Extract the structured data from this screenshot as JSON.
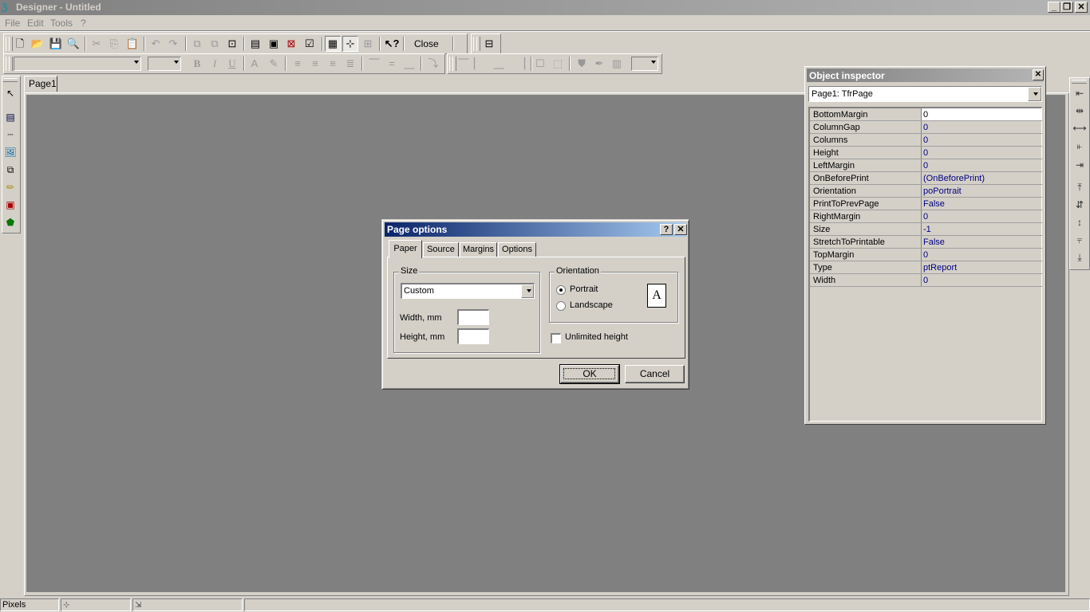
{
  "window": {
    "title": "Designer - Untitled"
  },
  "menu": [
    "File",
    "Edit",
    "Tools",
    "?"
  ],
  "toolbar": {
    "close_label": "Close"
  },
  "page_tab": {
    "label": "Page1"
  },
  "statusbar": {
    "units": "Pixels"
  },
  "dialog": {
    "title": "Page options",
    "help_glyph": "?",
    "close_glyph": "✕",
    "tabs": [
      "Paper",
      "Source",
      "Margins",
      "Options"
    ],
    "size_group": "Size",
    "size_value": "Custom",
    "width_label": "Width, mm",
    "height_label": "Height, mm",
    "width_value": "",
    "height_value": "",
    "orientation_group": "Orientation",
    "portrait_label": "Portrait",
    "landscape_label": "Landscape",
    "orientation_selected": "Portrait",
    "preview_glyph": "A",
    "unlimited_label": "Unlimited height",
    "unlimited_checked": false,
    "ok_label": "OK",
    "cancel_label": "Cancel"
  },
  "inspector": {
    "title": "Object inspector",
    "close_glyph": "✕",
    "selected_object": "Page1: TfrPage",
    "properties": [
      {
        "name": "BottomMargin",
        "value": "0"
      },
      {
        "name": "ColumnGap",
        "value": "0"
      },
      {
        "name": "Columns",
        "value": "0"
      },
      {
        "name": "Height",
        "value": "0"
      },
      {
        "name": "LeftMargin",
        "value": "0"
      },
      {
        "name": "OnBeforePrint",
        "value": "(OnBeforePrint)"
      },
      {
        "name": "Orientation",
        "value": "poPortrait"
      },
      {
        "name": "PrintToPrevPage",
        "value": "False"
      },
      {
        "name": "RightMargin",
        "value": "0"
      },
      {
        "name": "Size",
        "value": "-1"
      },
      {
        "name": "StretchToPrintable",
        "value": "False"
      },
      {
        "name": "TopMargin",
        "value": "0"
      },
      {
        "name": "Type",
        "value": "ptReport"
      },
      {
        "name": "Width",
        "value": "0"
      }
    ]
  },
  "caption_buttons": {
    "minimize": "_",
    "restore": "❐",
    "close": "✕"
  },
  "toolbar_icons": [
    "new-icon",
    "open-icon",
    "save-icon",
    "preview-icon",
    "cut-icon",
    "copy-icon",
    "paste-icon",
    "undo-icon",
    "redo-icon",
    "bring-front-icon",
    "send-back-icon",
    "group-icon",
    "insert-band-icon",
    "insert-object-icon",
    "delete-page-icon",
    "check-icon",
    "grid-icon",
    "snap-grid-icon",
    "align-grid-icon",
    "help-icon"
  ],
  "colors": {
    "face": "#d4d0c8",
    "canvas": "#808080",
    "dialog_title": "#0a246a",
    "inspector_value": "#000080"
  }
}
